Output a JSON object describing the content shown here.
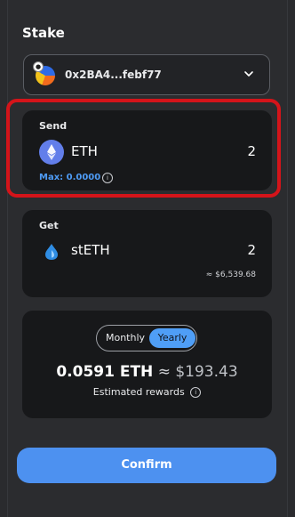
{
  "title": "Stake",
  "wallet": {
    "address": "0x2BA4...febf77"
  },
  "send": {
    "label": "Send",
    "asset": "ETH",
    "amount": "2",
    "max_label": "Max: 0.0000",
    "info_glyph": "i"
  },
  "get": {
    "label": "Get",
    "asset": "stETH",
    "amount": "2",
    "usd_value": "≈ $6,539.68"
  },
  "rewards": {
    "toggle_options": [
      "Monthly",
      "Yearly"
    ],
    "selected": "Yearly",
    "eth_amount": "0.0591 ETH",
    "approx": "≈",
    "usd_amount": "$193.43",
    "estimated_label": "Estimated rewards",
    "info_glyph": "i"
  },
  "confirm_label": "Confirm",
  "colors": {
    "accent": "#4d91f0",
    "highlight": "#d4141a",
    "max_text": "#4e9bf5",
    "eth_icon": "#627eea"
  }
}
